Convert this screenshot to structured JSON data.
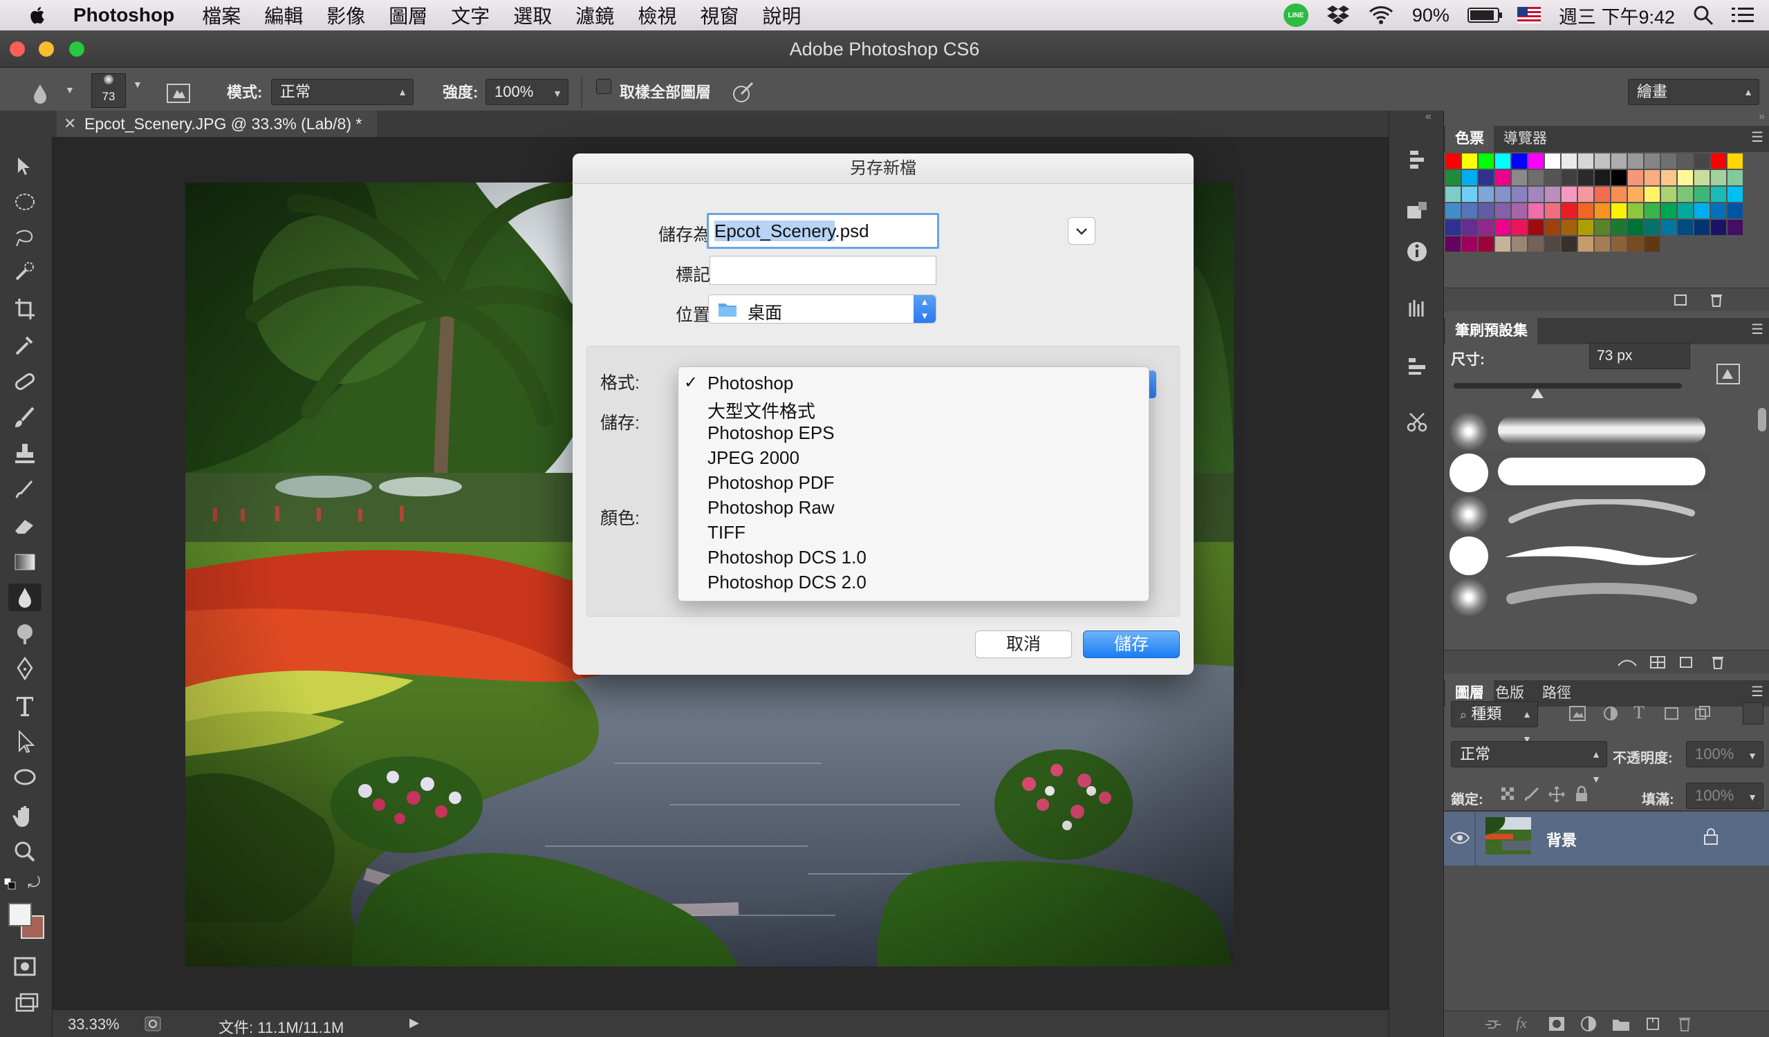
{
  "menubar": {
    "app_name": "Photoshop",
    "items": [
      "檔案",
      "編輯",
      "影像",
      "圖層",
      "文字",
      "選取",
      "濾鏡",
      "檢視",
      "視窗",
      "說明"
    ],
    "battery": "90%",
    "clock": "週三 下午9:42"
  },
  "window": {
    "title": "Adobe Photoshop CS6"
  },
  "options_bar": {
    "brush_size": "73",
    "mode_label": "模式:",
    "mode_value": "正常",
    "strength_label": "強度:",
    "strength_value": "100%",
    "sample_all_label": "取樣全部圖層",
    "workspace_value": "繪畫"
  },
  "document": {
    "tab_title": "Epcot_Scenery.JPG @ 33.3% (Lab/8) *",
    "zoom": "33.33%",
    "file_info": "文件: 11.1M/11.1M"
  },
  "panels": {
    "swatches": {
      "tab_active": "色票",
      "tab_other": "導覽器"
    },
    "brush_presets": {
      "tab": "筆刷預設集",
      "size_label": "尺寸:",
      "size_value": "73 px"
    },
    "layers": {
      "tabs": [
        "圖層",
        "色版",
        "路徑"
      ],
      "filter_kind": "種類",
      "blend_mode": "正常",
      "opacity_label": "不透明度:",
      "opacity_value": "100%",
      "lock_label": "鎖定:",
      "fill_label": "填滿:",
      "fill_value": "100%",
      "layer_name": "背景"
    }
  },
  "dialog": {
    "title": "另存新檔",
    "save_as_label": "儲存為:",
    "save_as_value": "Epcot_Scenery.psd",
    "save_as_selected_part": "Epcot_Scenery",
    "tags_label": "標記:",
    "tags_value": "",
    "location_label": "位置:",
    "location_value": "桌面",
    "format_label": "格式:",
    "save_label": "儲存:",
    "color_label": "顏色:",
    "format_options": [
      "Photoshop",
      "大型文件格式",
      "Photoshop EPS",
      "JPEG 2000",
      "Photoshop PDF",
      "Photoshop Raw",
      "TIFF",
      "Photoshop DCS 1.0",
      "Photoshop DCS 2.0"
    ],
    "format_selected": "Photoshop",
    "cancel_label": "取消",
    "save_button_label": "儲存"
  },
  "colors": {
    "accent_blue": "#2b7af0",
    "panel_bg": "#535353",
    "workspace_bg": "#282828"
  },
  "icons": [
    "apple-icon",
    "line-icon",
    "dropbox-icon",
    "wifi-icon",
    "battery-icon",
    "flag-icon",
    "search-icon",
    "list-icon",
    "blur-tool-icon",
    "folder-icon",
    "eye-icon",
    "lock-icon",
    "checkmark-icon",
    "chevron-down-icon"
  ]
}
